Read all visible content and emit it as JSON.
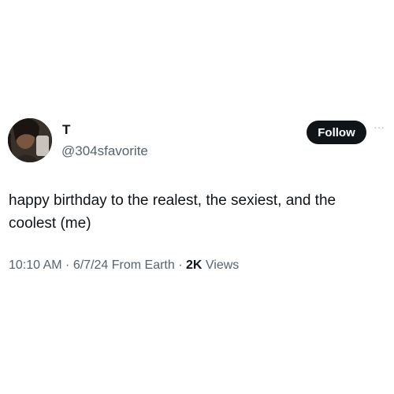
{
  "user": {
    "display_name": "T",
    "handle": "@304sfavorite"
  },
  "actions": {
    "follow_label": "Follow",
    "more_label": "···"
  },
  "tweet": {
    "text": "happy birthday to the realest, the sexiest, and the coolest (me)"
  },
  "meta": {
    "time": "10:10 AM",
    "sep1": " · ",
    "date": "6/7/24",
    "source": " From Earth",
    "sep2": " · ",
    "views_count": "2K",
    "views_label": " Views"
  },
  "colors": {
    "primary_text": "#0f1419",
    "secondary_text": "#536471",
    "follow_bg": "#0f1419",
    "follow_text": "#ffffff"
  }
}
